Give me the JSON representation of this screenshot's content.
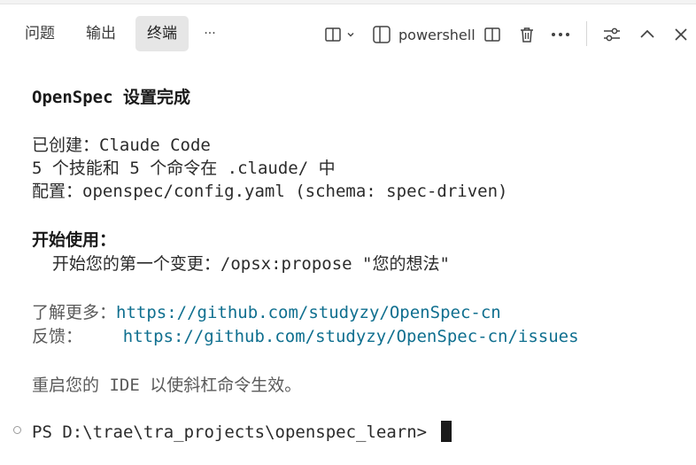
{
  "panel": {
    "tabs": [
      {
        "label": "问题"
      },
      {
        "label": "输出"
      },
      {
        "label": "终端"
      },
      {
        "label": "···"
      }
    ],
    "active_tab": "终端",
    "terminal_name": "powershell"
  },
  "terminal": {
    "heading_bold": "OpenSpec",
    "heading_rest": " 设置完成",
    "created_label": "已创建：",
    "created_value": "Claude Code",
    "counts_line": "5 个技能和 5 个命令在 .claude/ 中",
    "config_label": "配置：",
    "config_value": "openspec/config.yaml (schema: spec-driven)",
    "start_heading": "开始使用：",
    "start_text": "  开始您的第一个变更：",
    "start_command": "/opsx:propose \"您的想法\"",
    "learn_label": "了解更多：",
    "learn_url": "https://github.com/studyzy/OpenSpec-cn",
    "feedback_label": "反馈：    ",
    "feedback_url": "https://github.com/studyzy/OpenSpec-cn/issues",
    "restart_note": "重启您的 IDE 以使斜杠命令生效。",
    "prompt": "PS D:\\trae\\tra_projects\\openspec_learn> "
  }
}
